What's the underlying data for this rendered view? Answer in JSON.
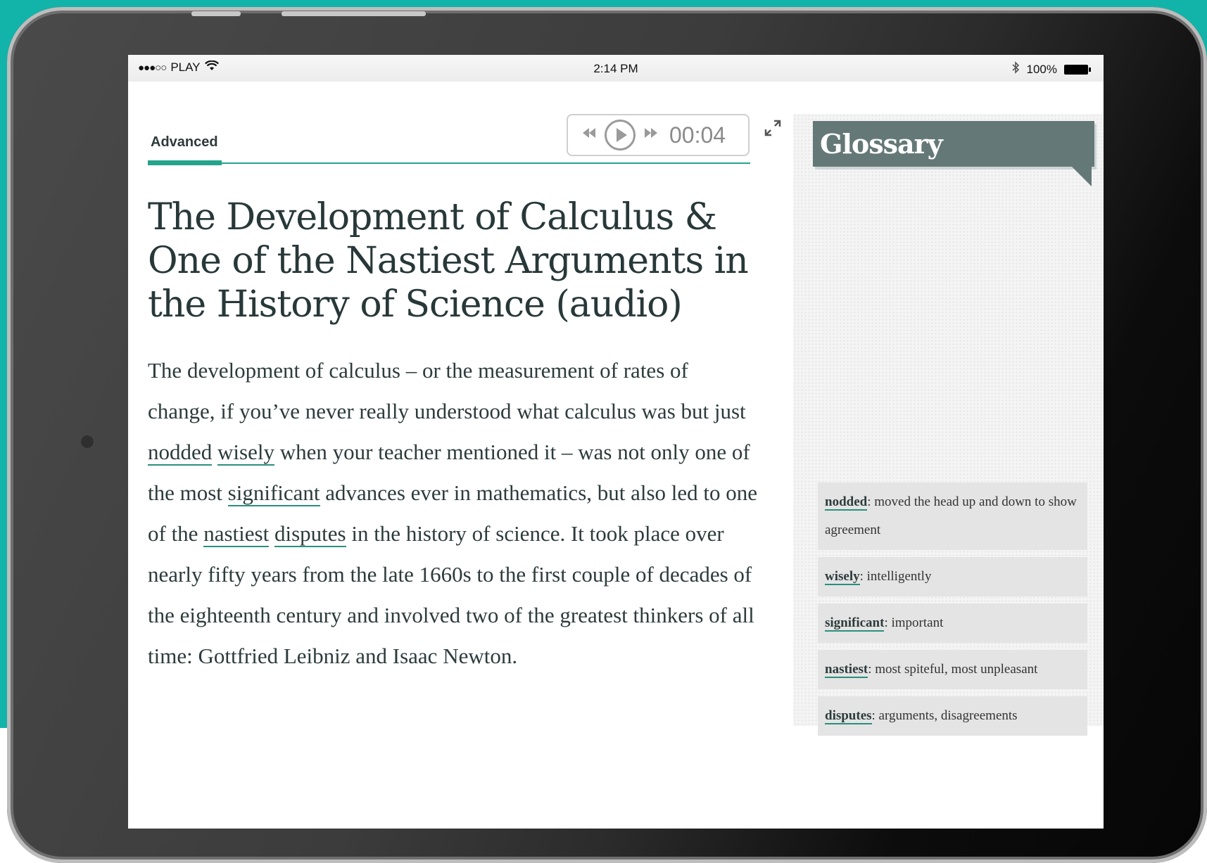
{
  "status_bar": {
    "carrier": "PLAY",
    "signal": "●●●○○",
    "time": "2:14 PM",
    "battery": "100%"
  },
  "tabs": {
    "level": "Advanced"
  },
  "player": {
    "time": "00:04"
  },
  "article": {
    "title": "The Development of Calculus & One of the Nastiest Arguments in the History of Science (audio)",
    "body": {
      "p1": "The development of calculus – or the measurement of rates of change, if you’ve never really understood what calculus was but just ",
      "w1": "nodded",
      "s1": " ",
      "w2": "wisely",
      "p2": " when your teacher mentioned it – was not only one of the most ",
      "w3": "significant",
      "p3": " advances ever in mathematics, but also led to one of the ",
      "w4": "nastiest",
      "s2": " ",
      "w5": "disputes",
      "p4": " in the history of science. It took place over nearly fifty years from the late 1660s to the first couple of decades of the eighteenth century and involved two of the greatest thinkers of all time: Gottfried Leibniz and Isaac Newton."
    }
  },
  "glossary": {
    "title": "Glossary",
    "items": [
      {
        "term": "nodded",
        "definition": ": moved the head up and down to show agreement"
      },
      {
        "term": "wisely",
        "definition": ": intelligently"
      },
      {
        "term": "significant",
        "definition": ": important"
      },
      {
        "term": "nastiest",
        "definition": ": most spiteful, most unpleasant"
      },
      {
        "term": "disputes",
        "definition": ": arguments, disagreements"
      }
    ]
  },
  "icons": {
    "wifi": "wifi-icon",
    "bluetooth": "bluetooth-icon",
    "rewind": "rewind-icon",
    "play": "play-icon",
    "forward": "fast-forward-icon",
    "expand": "expand-icon"
  }
}
